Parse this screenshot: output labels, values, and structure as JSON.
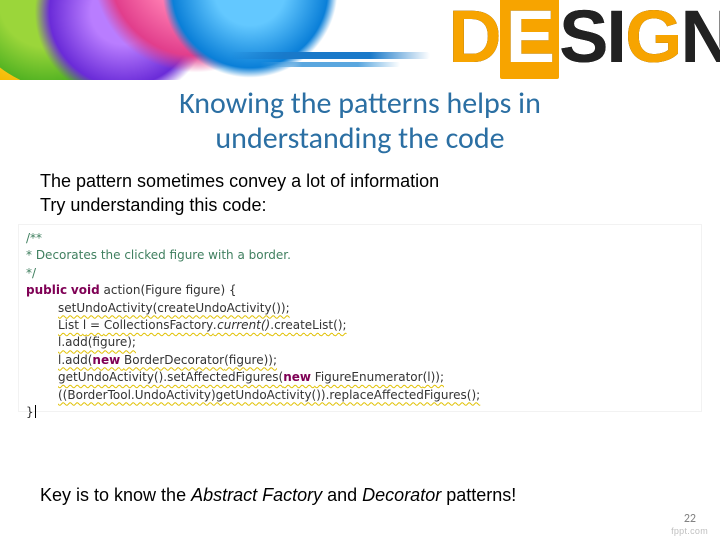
{
  "banner": {
    "word": "DESIGN"
  },
  "title": {
    "line1": "Knowing the patterns helps in",
    "line2": "understanding the code"
  },
  "body": {
    "line1": "The pattern sometimes convey a lot of information",
    "line2": "Try understanding this code:"
  },
  "code": {
    "c1": "/**",
    "c2": "* Decorates the clicked figure with a border.",
    "c3": "*/",
    "kw_public": "public",
    "kw_void": "void",
    "kw_new": "new",
    "m_action": "action",
    "p_type": "Figure",
    "p_name": "figure",
    "l1a": "setUndoActivity(createUndoActivity());",
    "l2_list": "List",
    "l2_l": "l",
    "l2_eq": " = ",
    "l2_cls": "CollectionsFactory",
    "l2_cur": ".current()",
    "l2_cl": ".createList();",
    "l3": "l.add(figure);",
    "l4_pre": "l.add(",
    "l4_cls": "BorderDecorator",
    "l4_post": "(figure));",
    "l5_pre": "getUndoActivity().setAffectedFigures(",
    "l5_cls": "FigureEnumerator",
    "l5_post": "(l));",
    "l6_pre": "((BorderTool.UndoActivity)getUndoActivity()).replaceAffectedFigures();",
    "brace_close": "}"
  },
  "keyline": {
    "pre": "Key is to know the ",
    "em1": "Abstract Factory",
    "mid": " and ",
    "em2": "Decorator",
    "post": " patterns!"
  },
  "meta": {
    "page": "22",
    "watermark": "fppt.com"
  }
}
